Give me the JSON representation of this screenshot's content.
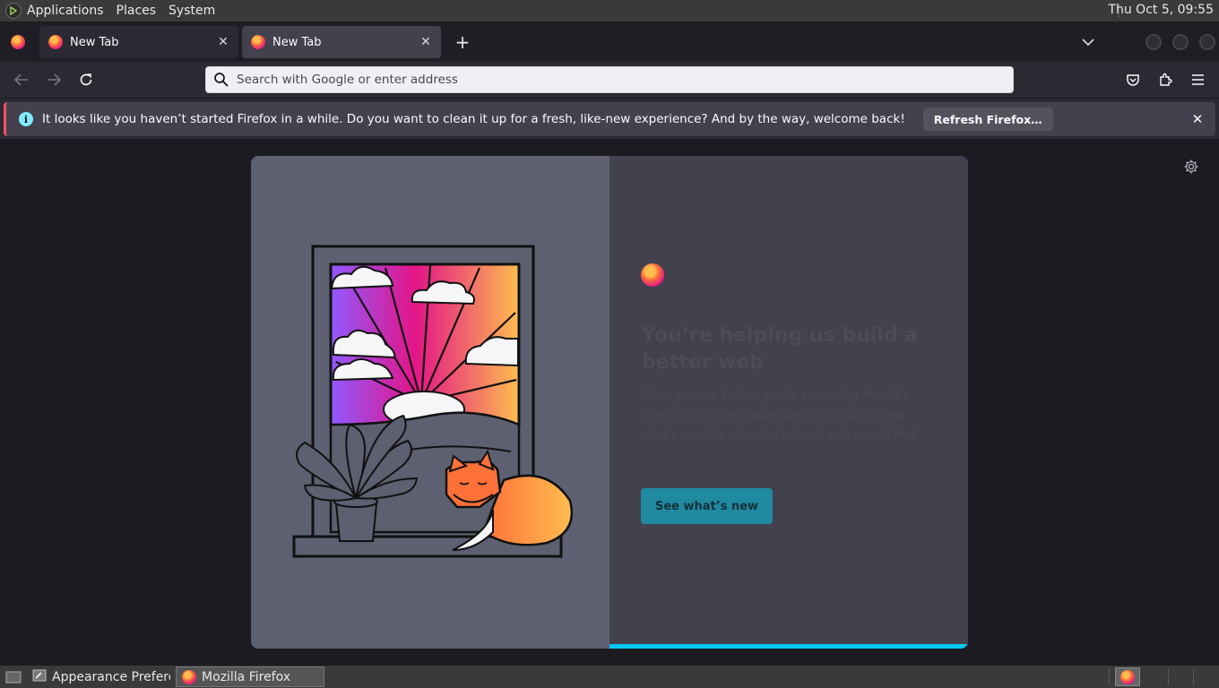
{
  "top_panel": {
    "menus": [
      "Applications",
      "Places",
      "System"
    ],
    "clock": "Thu Oct  5, 09:55"
  },
  "tabs": [
    {
      "label": "New Tab",
      "active": false
    },
    {
      "label": "New Tab",
      "active": true
    }
  ],
  "urlbar": {
    "placeholder": "Search with Google or enter address",
    "value": ""
  },
  "notification": {
    "message": "It looks like you haven’t started Firefox in a while. Do you want to clean it up for a fresh, like-new experience? And by the way, welcome back!",
    "button_label": "Refresh Firefox…"
  },
  "onboarding": {
    "heading": "You’re helping us build a better web",
    "body": "When you use Firefox, you’re supporting Mozilla’s mission. With every download, you help us show what’s possible when the internet puts people first.",
    "cta_label": "See what’s new",
    "progress_fraction": 1.0
  },
  "taskbar": {
    "items": [
      {
        "label": "Appearance Prefere…",
        "active": false
      },
      {
        "label": "Mozilla Firefox",
        "active": true
      }
    ]
  },
  "colors": {
    "accent": "#00c8f0",
    "notification_stripe": "#ff4f5e",
    "chrome_dark": "#1f1e25",
    "chrome_toolbar": "#2b2a33"
  }
}
